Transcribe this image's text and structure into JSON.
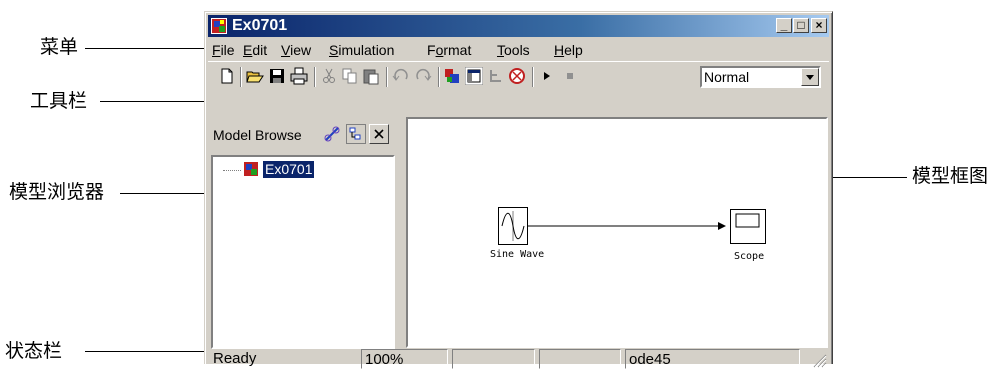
{
  "annotations": {
    "menu": "菜单",
    "toolbar": "工具栏",
    "browser": "模型浏览器",
    "canvas": "模型框图",
    "statusbar": "状态栏"
  },
  "window": {
    "title": "Ex0701",
    "caption_buttons": [
      "_",
      "□",
      "×"
    ]
  },
  "menu": {
    "items": [
      {
        "prefix": "",
        "key": "F",
        "rest": "ile"
      },
      {
        "prefix": "",
        "key": "E",
        "rest": "dit"
      },
      {
        "prefix": "",
        "key": "V",
        "rest": "iew"
      },
      {
        "prefix": "",
        "key": "S",
        "rest": "imulation"
      },
      {
        "prefix": "F",
        "key": "o",
        "rest": "rmat"
      },
      {
        "prefix": "",
        "key": "T",
        "rest": "ools"
      },
      {
        "prefix": "",
        "key": "H",
        "rest": "elp"
      }
    ]
  },
  "toolbar": {
    "icons": [
      "new-icon",
      "open-icon",
      "save-icon",
      "print-icon",
      "cut-icon",
      "copy-icon",
      "paste-icon",
      "undo-icon",
      "redo-icon",
      "library-icon",
      "browser-toggle-icon",
      "hierarchy-icon",
      "debug-icon",
      "play-icon",
      "stop-icon"
    ],
    "mode_value": "Normal"
  },
  "browser": {
    "title": "Model Browse",
    "tree_root": "Ex0701"
  },
  "canvas": {
    "blocks": {
      "sine_label": "Sine Wave",
      "scope_label": "Scope"
    }
  },
  "statusbar": {
    "status": "Ready",
    "zoom": "100%",
    "empty1": "",
    "empty2": "",
    "solver": "ode45"
  },
  "colors": {
    "window_face": "#d4d0c8",
    "title_gradient_start": "#0a246a",
    "title_gradient_end": "#a6caf0",
    "selection": "#0a246a"
  }
}
